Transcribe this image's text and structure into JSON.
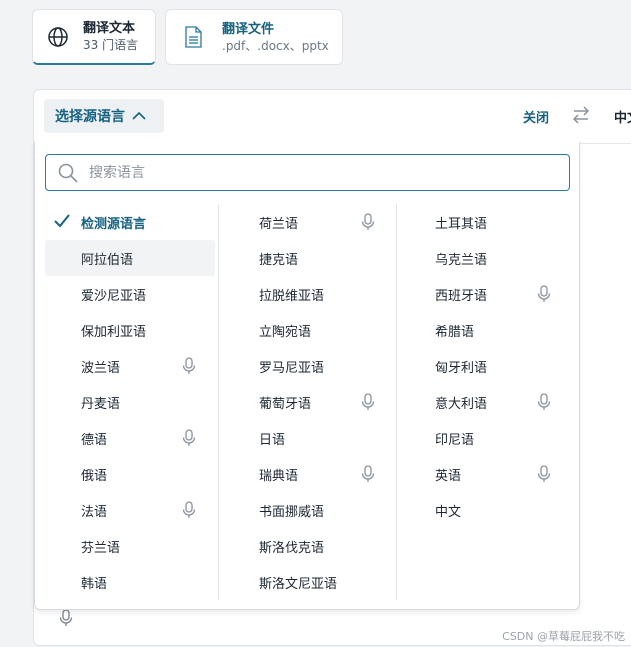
{
  "tabs": [
    {
      "title": "翻译文本",
      "subtitle": "33 门语言",
      "icon": "globe-icon",
      "active": true
    },
    {
      "title": "翻译文件",
      "subtitle": ".pdf、.docx、pptx",
      "icon": "document-icon",
      "active": false
    }
  ],
  "toolbar": {
    "source_button_label": "选择源语言",
    "close_label": "关闭",
    "target_language": "中文"
  },
  "search": {
    "placeholder": "搜索语言",
    "value": ""
  },
  "languages": {
    "col1": [
      {
        "label": "检测源语言",
        "selected": true,
        "mic": false
      },
      {
        "label": "阿拉伯语",
        "hover": true,
        "mic": false
      },
      {
        "label": "爱沙尼亚语",
        "mic": false
      },
      {
        "label": "保加利亚语",
        "mic": false
      },
      {
        "label": "波兰语",
        "mic": true
      },
      {
        "label": "丹麦语",
        "mic": false
      },
      {
        "label": "德语",
        "mic": true
      },
      {
        "label": "俄语",
        "mic": false
      },
      {
        "label": "法语",
        "mic": true
      },
      {
        "label": "芬兰语",
        "mic": false
      },
      {
        "label": "韩语",
        "mic": false
      }
    ],
    "col2": [
      {
        "label": "荷兰语",
        "mic": true
      },
      {
        "label": "捷克语",
        "mic": false
      },
      {
        "label": "拉脱维亚语",
        "mic": false
      },
      {
        "label": "立陶宛语",
        "mic": false
      },
      {
        "label": "罗马尼亚语",
        "mic": false
      },
      {
        "label": "葡萄牙语",
        "mic": true
      },
      {
        "label": "日语",
        "mic": false
      },
      {
        "label": "瑞典语",
        "mic": true
      },
      {
        "label": "书面挪威语",
        "mic": false
      },
      {
        "label": "斯洛伐克语",
        "mic": false
      },
      {
        "label": "斯洛文尼亚语",
        "mic": false
      }
    ],
    "col3": [
      {
        "label": "土耳其语",
        "mic": false
      },
      {
        "label": "乌克兰语",
        "mic": false
      },
      {
        "label": "西班牙语",
        "mic": true
      },
      {
        "label": "希腊语",
        "mic": false
      },
      {
        "label": "匈牙利语",
        "mic": false
      },
      {
        "label": "意大利语",
        "mic": true
      },
      {
        "label": "印尼语",
        "mic": false
      },
      {
        "label": "英语",
        "mic": true
      },
      {
        "label": "中文",
        "mic": false
      }
    ]
  },
  "watermark": "CSDN @草莓屁屁我不吃",
  "colors": {
    "accent": "#16627f",
    "border_active": "#2a7aa0"
  }
}
